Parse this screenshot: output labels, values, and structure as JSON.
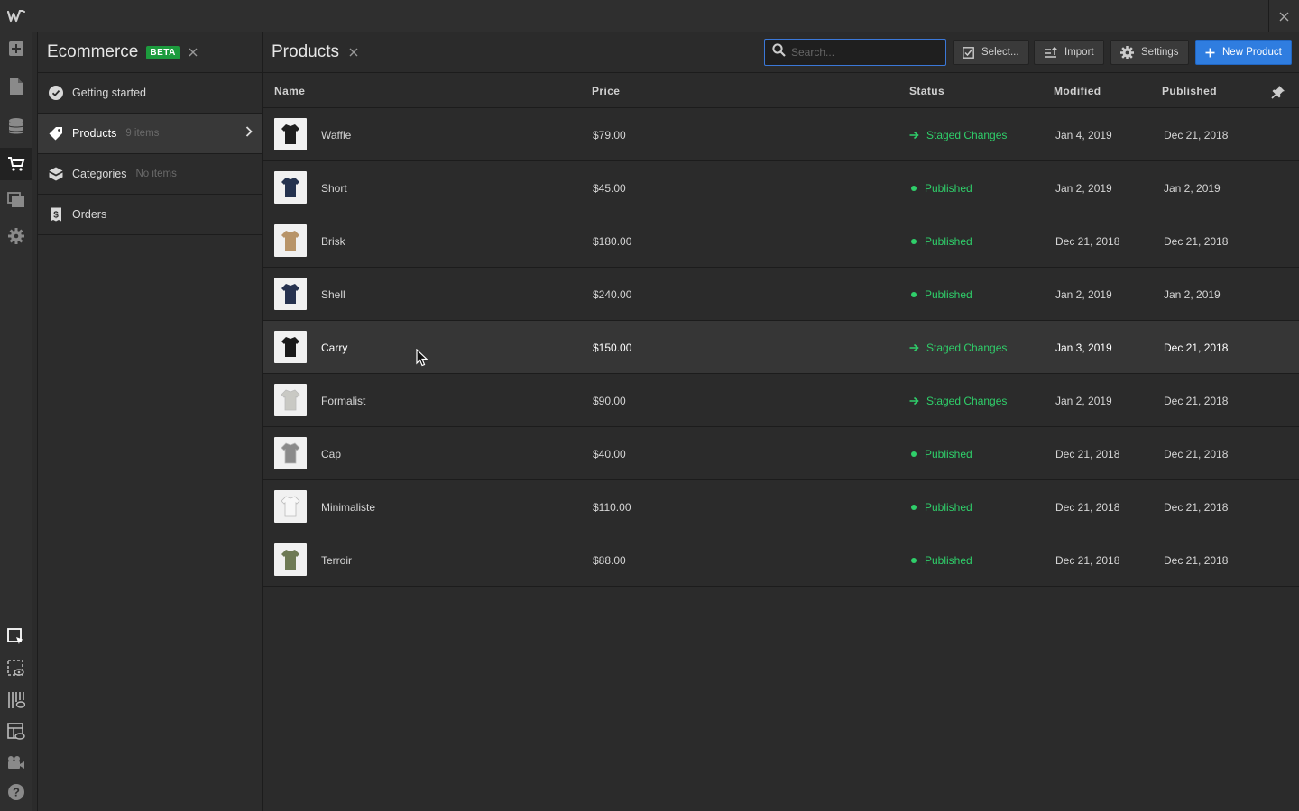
{
  "panel": {
    "title": "Ecommerce",
    "badge": "BETA",
    "items": [
      {
        "label": "Getting started",
        "count": ""
      },
      {
        "label": "Products",
        "count": "9 items"
      },
      {
        "label": "Categories",
        "count": "No items"
      },
      {
        "label": "Orders",
        "count": ""
      }
    ]
  },
  "main": {
    "title": "Products",
    "search_placeholder": "Search...",
    "buttons": {
      "select": "Select...",
      "import": "Import",
      "settings": "Settings",
      "new_product": "New Product"
    }
  },
  "table": {
    "columns": [
      "Name",
      "Price",
      "Status",
      "Modified",
      "Published"
    ],
    "rows": [
      {
        "name": "Waffle",
        "price": "$79.00",
        "status": "Staged Changes",
        "modified": "Jan 4, 2019",
        "published": "Dec 21, 2018",
        "thumb": "#1e1e1e"
      },
      {
        "name": "Short",
        "price": "$45.00",
        "status": "Published",
        "modified": "Jan 2, 2019",
        "published": "Jan 2, 2019",
        "thumb": "#24324e"
      },
      {
        "name": "Brisk",
        "price": "$180.00",
        "status": "Published",
        "modified": "Dec 21, 2018",
        "published": "Dec 21, 2018",
        "thumb": "#b89468"
      },
      {
        "name": "Shell",
        "price": "$240.00",
        "status": "Published",
        "modified": "Jan 2, 2019",
        "published": "Jan 2, 2019",
        "thumb": "#26324f"
      },
      {
        "name": "Carry",
        "price": "$150.00",
        "status": "Staged Changes",
        "modified": "Jan 3, 2019",
        "published": "Dec 21, 2018",
        "thumb": "#1a1a1a"
      },
      {
        "name": "Formalist",
        "price": "$90.00",
        "status": "Staged Changes",
        "modified": "Jan 2, 2019",
        "published": "Dec 21, 2018",
        "thumb": "#c9c9c4"
      },
      {
        "name": "Cap",
        "price": "$40.00",
        "status": "Published",
        "modified": "Dec 21, 2018",
        "published": "Dec 21, 2018",
        "thumb": "#8a8a8a"
      },
      {
        "name": "Minimaliste",
        "price": "$110.00",
        "status": "Published",
        "modified": "Dec 21, 2018",
        "published": "Dec 21, 2018",
        "thumb": "#f7f7f7"
      },
      {
        "name": "Terroir",
        "price": "$88.00",
        "status": "Published",
        "modified": "Dec 21, 2018",
        "published": "Dec 21, 2018",
        "thumb": "#6e7a55"
      }
    ]
  },
  "colors": {
    "accent": "#2f7de0",
    "status_green": "#2fcf6a",
    "beta_green": "#1c9b3d"
  }
}
